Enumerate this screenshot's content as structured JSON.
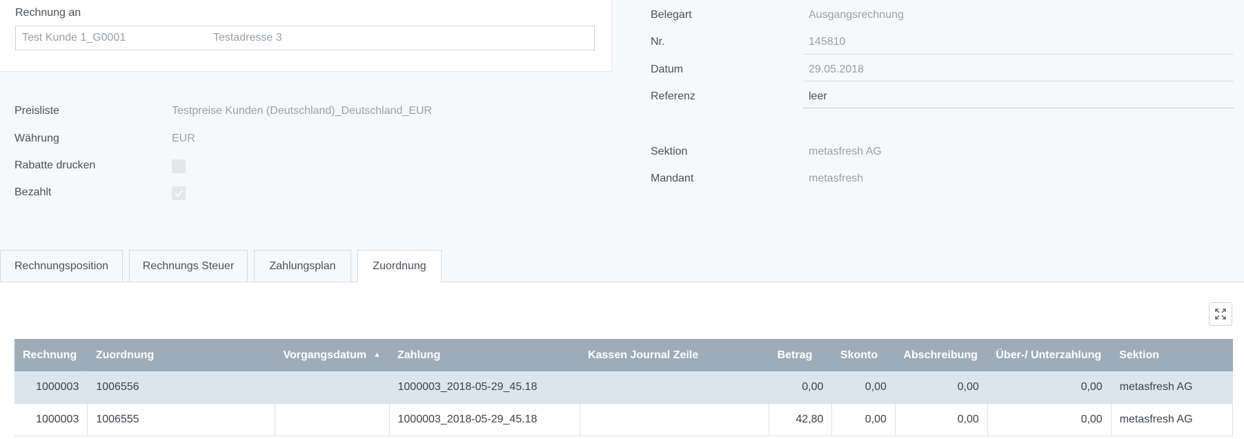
{
  "header": {
    "bill_to_label": "Rechnung an",
    "bill_to_customer": "Test Kunde 1_G0001",
    "bill_to_address": "Testadresse 3"
  },
  "doc_info": {
    "belegart_label": "Belegart",
    "belegart_value": "Ausgangsrechnung",
    "nr_label": "Nr.",
    "nr_value": "145810",
    "datum_label": "Datum",
    "datum_value": "29.05.2018",
    "referenz_label": "Referenz",
    "referenz_value": "leer",
    "sektion_label": "Sektion",
    "sektion_value": "metasfresh AG",
    "mandant_label": "Mandant",
    "mandant_value": "metasfresh"
  },
  "settings": {
    "preisliste_label": "Preisliste",
    "preisliste_value": "Testpreise Kunden (Deutschland)_Deutschland_EUR",
    "waehrung_label": "Währung",
    "waehrung_value": "EUR",
    "rabatte_label": "Rabatte drucken",
    "rabatte_checked": false,
    "bezahlt_label": "Bezahlt",
    "bezahlt_checked": true
  },
  "tabs": [
    {
      "label": "Rechnungsposition",
      "active": false
    },
    {
      "label": "Rechnungs Steuer",
      "active": false
    },
    {
      "label": "Zahlungsplan",
      "active": false
    },
    {
      "label": "Zuordnung",
      "active": true
    }
  ],
  "table": {
    "columns": [
      "Rechnung",
      "Zuordnung",
      "Vorgangsdatum",
      "Zahlung",
      "Kassen Journal Zeile",
      "Betrag",
      "Skonto",
      "Abschreibung",
      "Über-/ Unterzahlung",
      "Sektion"
    ],
    "sorted_column": "Vorgangsdatum",
    "sort_direction": "ascending",
    "rows": [
      [
        "1000003",
        "1006556",
        "",
        "1000003_2018-05-29_45.18",
        "",
        "0,00",
        "0,00",
        "0,00",
        "0,00",
        "metasfresh AG"
      ],
      [
        "1000003",
        "1006555",
        "",
        "1000003_2018-05-29_45.18",
        "",
        "42,80",
        "0,00",
        "0,00",
        "0,00",
        "metasfresh AG"
      ]
    ]
  },
  "icons": {
    "expand": "expand-icon",
    "sort": "sort-ascending-icon",
    "check": "check-icon"
  },
  "colors": {
    "table_header": "#9eacb8",
    "selected_row": "#dbe5ec"
  }
}
